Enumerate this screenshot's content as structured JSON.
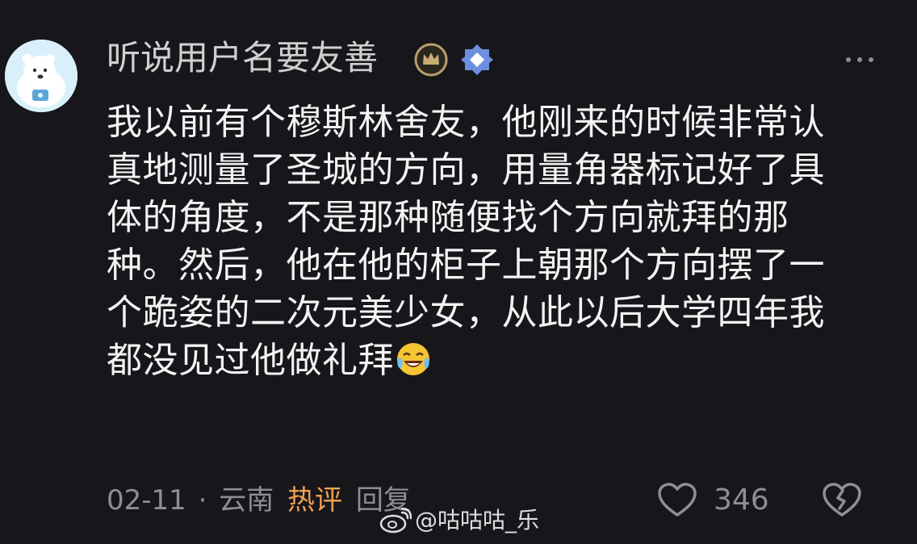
{
  "comment": {
    "username": "听说用户名要友善",
    "icons": {
      "avatar": "polar-bear-avatar-icon",
      "badge_1": "crown-badge-icon",
      "badge_2": "diamond-badge-icon",
      "more": "more-dots-icon",
      "emoji": "laughing-crying-emoji-icon",
      "like": "heart-icon",
      "dislike": "broken-heart-icon"
    },
    "lines": [
      "我以前有个穆斯林舍友，他刚来的时候非常认",
      "真地测量了圣城的方向，用量角器标记好了具",
      "体的角度，不是那种随便找个方向就拜的那",
      "种。然后，他在他的柜子上朝那个方向摆了一",
      "个跪姿的二次元美少女，从此以后大学四年我",
      "都没见过他做礼拜"
    ],
    "date": "02-11",
    "separator": "·",
    "location": "云南",
    "hot_label": "热评",
    "reply_label": "回复",
    "like_count": "346"
  },
  "watermark": {
    "text": "@咕咕咕_乐",
    "icon": "weibo-icon"
  },
  "colors": {
    "background": "#17161b",
    "hot_accent": "#f0a050",
    "meta_text": "#8e8e93"
  }
}
